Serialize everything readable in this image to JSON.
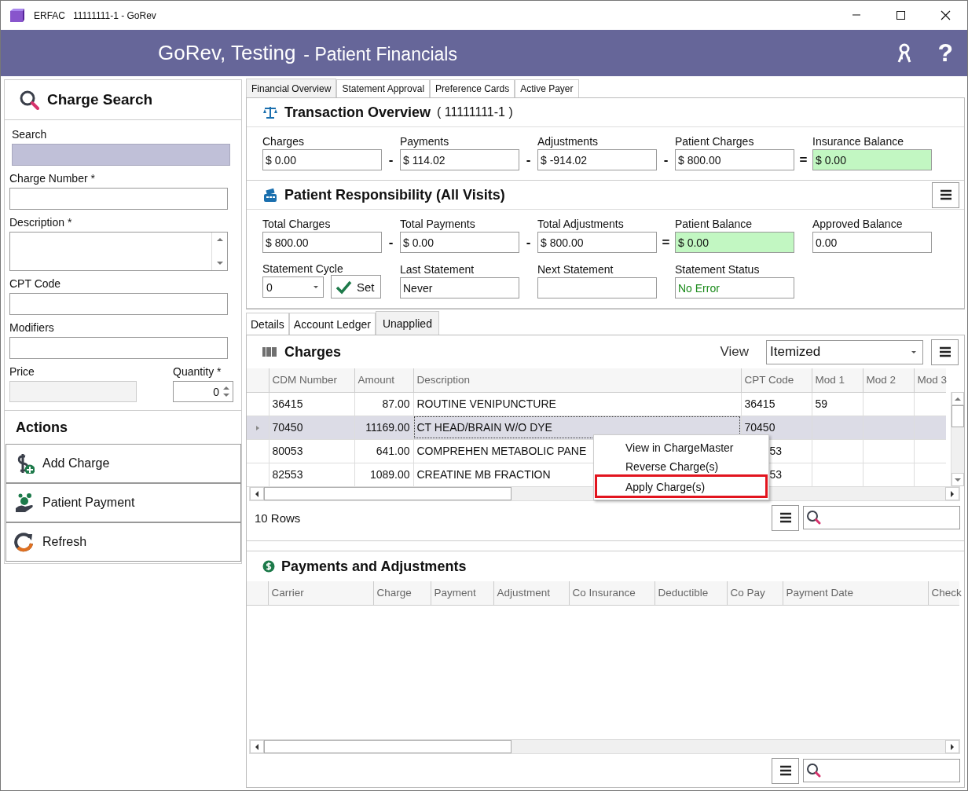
{
  "window": {
    "title": "ERFAC   11111111-1 - GoRev"
  },
  "header": {
    "patient": "GoRev, Testing",
    "page": "- Patient Financials",
    "help": "?"
  },
  "sidebar": {
    "title": "Charge Search",
    "fields": [
      {
        "label": "Search",
        "kind": "search"
      },
      {
        "label": "Charge Number *",
        "kind": "text"
      },
      {
        "label": "Description *",
        "kind": "textarea"
      },
      {
        "label": "CPT Code",
        "kind": "text"
      },
      {
        "label": "Modifiers",
        "kind": "text"
      }
    ],
    "price": {
      "label": "Price"
    },
    "quantity": {
      "label": "Quantity *",
      "value": "0"
    },
    "actions_title": "Actions",
    "actions": [
      {
        "label": "Add Charge",
        "kind": "add"
      },
      {
        "label": "Patient Payment",
        "kind": "payment"
      },
      {
        "label": "Refresh",
        "kind": "refresh"
      }
    ]
  },
  "tabs": [
    {
      "label": "Financial Overview",
      "selected": true
    },
    {
      "label": "Statement Approval",
      "selected": false
    },
    {
      "label": "Preference Cards",
      "selected": false
    },
    {
      "label": "Active Payer",
      "selected": false
    }
  ],
  "transaction": {
    "title": "Transaction Overview",
    "account": "( 11111111-1 )",
    "fields": [
      {
        "label": "Charges",
        "value": "$ 0.00",
        "highlight": false
      },
      {
        "op": "-",
        "label": "Payments",
        "value": "$ 114.02",
        "highlight": false
      },
      {
        "op": "-",
        "label": "Adjustments",
        "value": "$ -914.02",
        "highlight": false
      },
      {
        "op": "-",
        "label": "Patient Charges",
        "value": "$ 800.00",
        "highlight": false
      },
      {
        "op": "=",
        "label": "Insurance Balance",
        "value": "$ 0.00",
        "highlight": true
      }
    ]
  },
  "responsibility": {
    "title": "Patient Responsibility (All Visits)",
    "fields": [
      {
        "label": "Total Charges",
        "value": "$ 800.00",
        "highlight": false
      },
      {
        "op": "-",
        "label": "Total Payments",
        "value": "$ 0.00",
        "highlight": false
      },
      {
        "op": "-",
        "label": "Total Adjustments",
        "value": "$ 800.00",
        "highlight": false
      },
      {
        "op": "=",
        "label": "Patient Balance",
        "value": "$ 0.00",
        "highlight": true
      },
      {
        "label": "Approved Balance",
        "value": "0.00",
        "highlight": false
      }
    ],
    "statement_cycle": {
      "label": "Statement Cycle",
      "value": "0",
      "button": "Set"
    },
    "last_statement": {
      "label": "Last Statement",
      "value": "Never"
    },
    "next_statement": {
      "label": "Next Statement"
    },
    "statement_status": {
      "label": "Statement Status",
      "value": "No Error"
    }
  },
  "subtabs": [
    {
      "label": "Details",
      "selected": false
    },
    {
      "label": "Account Ledger",
      "selected": false
    },
    {
      "label": "Unapplied",
      "selected": true
    }
  ],
  "charges": {
    "title": "Charges",
    "view_label": "View",
    "view": "Itemized",
    "columns": [
      "CDM Number",
      "Amount",
      "Description",
      "CPT Code",
      "Mod 1",
      "Mod 2",
      "Mod 3"
    ],
    "rows": [
      {
        "selected": false,
        "cells": [
          "36415",
          "87.00",
          "ROUTINE VENIPUNCTURE",
          "36415",
          "59",
          "",
          ""
        ]
      },
      {
        "selected": true,
        "cells": [
          "70450",
          "11169.00",
          "CT HEAD/BRAIN W/O DYE",
          "70450",
          "",
          "",
          ""
        ]
      },
      {
        "selected": false,
        "covered": true,
        "cells": [
          "80053",
          "641.00",
          "COMPREHEN METABOLIC PANE",
          "53",
          "",
          "",
          ""
        ]
      },
      {
        "selected": false,
        "covered": true,
        "cells": [
          "82553",
          "1089.00",
          "CREATINE MB FRACTION",
          "53",
          "",
          "",
          ""
        ]
      }
    ],
    "row_count": "10 Rows"
  },
  "context_menu": {
    "items": [
      {
        "label": "View in ChargeMaster",
        "highlighted": false
      },
      {
        "label": "Reverse Charge(s)",
        "highlighted": false
      },
      {
        "label": "Apply Charge(s)",
        "highlighted": true
      }
    ]
  },
  "payments": {
    "title": "Payments and Adjustments",
    "columns": [
      "Carrier",
      "Charge",
      "Payment",
      "Adjustment",
      "Co Insurance",
      "Deductible",
      "Co Pay",
      "Payment Date",
      "Check"
    ]
  }
}
